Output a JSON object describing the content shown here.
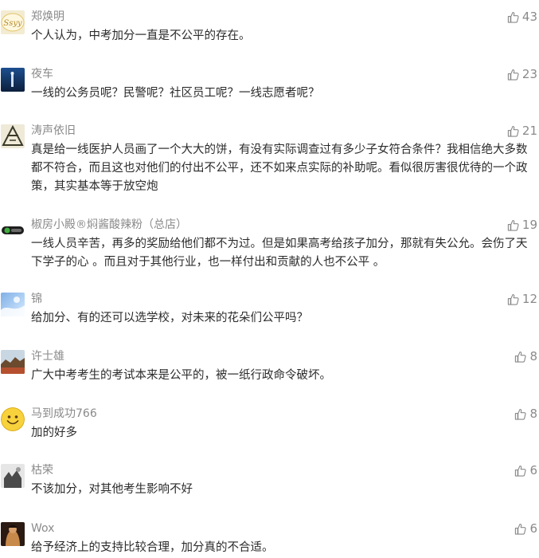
{
  "comments": [
    {
      "name": "郑焕明",
      "likes": "43",
      "text": "个人认为，中考加分一直是不公平的存在。"
    },
    {
      "name": "夜车",
      "likes": "23",
      "text": "一线的公务员呢？民警呢？社区员工呢？一线志愿者呢？"
    },
    {
      "name": "涛声依旧",
      "likes": "21",
      "text": "真是给一线医护人员画了一个大大的饼，有没有实际调查过有多少子女符合条件？我相信绝大多数都不符合，而且这也对他们的付出不公平，还不如来点实际的补助呢。看似很厉害很优待的一个政策，其实基本等于放空炮"
    },
    {
      "name": "椒房小殿®焖酱酸辣粉（总店）",
      "likes": "19",
      "text": "一线人员辛苦，再多的奖励给他们都不为过。但是如果高考给孩子加分，那就有失公允。会伤了天下学子的心  。而且对于其他行业，也一样付出和贡献的人也不公平 。"
    },
    {
      "name": "锦",
      "likes": "12",
      "text": "给加分、有的还可以选学校，对未来的花朵们公平吗？"
    },
    {
      "name": "许士雄",
      "likes": "8",
      "text": "广大中考考生的考试本来是公平的，被一纸行政命令破坏。"
    },
    {
      "name": "马到成功766",
      "likes": "8",
      "text": "加的好多"
    },
    {
      "name": "枯荣",
      "likes": "6",
      "text": "不该加分，对其他考生影响不好"
    },
    {
      "name": "Wox",
      "likes": "6",
      "text": "给予经济上的支持比较合理，加分真的不合适。"
    }
  ],
  "avatar_logo_text": "Ssyy"
}
